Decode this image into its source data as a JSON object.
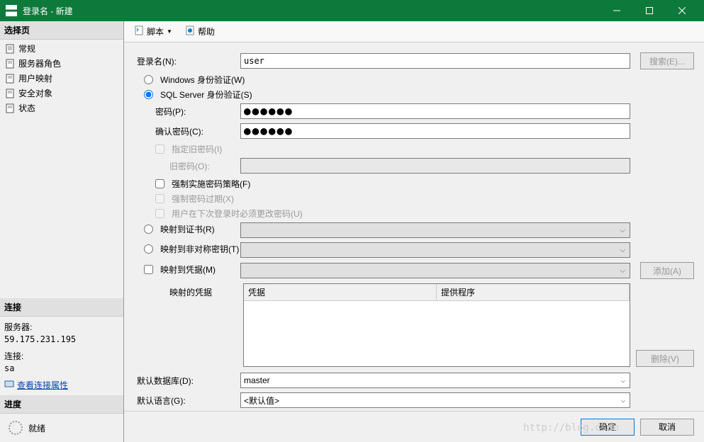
{
  "window": {
    "title": "登录名 - 新建"
  },
  "leftPanel": {
    "selectPageHeader": "选择页",
    "navItems": [
      {
        "label": "常规",
        "selected": true
      },
      {
        "label": "服务器角色"
      },
      {
        "label": "用户映射"
      },
      {
        "label": "安全对象"
      },
      {
        "label": "状态"
      }
    ],
    "connectionHeader": "连接",
    "serverLabel": "服务器:",
    "serverValue": "59.175.231.195",
    "connLabel": "连接:",
    "connValue": "sa",
    "viewConnProps": "查看连接属性",
    "progressHeader": "进度",
    "statusText": "就绪"
  },
  "toolbar": {
    "script": "脚本",
    "help": "帮助"
  },
  "form": {
    "loginNameLabel": "登录名(N):",
    "loginNameValue": "user",
    "searchBtn": "搜索(E)...",
    "windowsAuth": "Windows 身份验证(W)",
    "sqlAuth": "SQL Server 身份验证(S)",
    "passwordLabel": "密码(P):",
    "passwordValue": "●●●●●●",
    "confirmPasswordLabel": "确认密码(C):",
    "confirmPasswordValue": "●●●●●●",
    "specifyOldPassword": "指定旧密码(I)",
    "oldPasswordLabel": "旧密码(O):",
    "enforcePolicy": "强制实施密码策略(F)",
    "enforceExpiration": "强制密码过期(X)",
    "mustChange": "用户在下次登录时必须更改密码(U)",
    "mapToCert": "映射到证书(R)",
    "mapToAsymKey": "映射到非对称密钥(T)",
    "mapToCredential": "映射到凭据(M)",
    "addBtn": "添加(A)",
    "mappedCredentials": "映射的凭据",
    "credColumn": "凭据",
    "providerColumn": "提供程序",
    "removeBtn": "删除(V)",
    "defaultDbLabel": "默认数据库(D):",
    "defaultDbValue": "master",
    "defaultLangLabel": "默认语言(G):",
    "defaultLangValue": "<默认值>"
  },
  "footer": {
    "ok": "确定",
    "cancel": "取消"
  },
  "watermark": "http://blog.csdn"
}
